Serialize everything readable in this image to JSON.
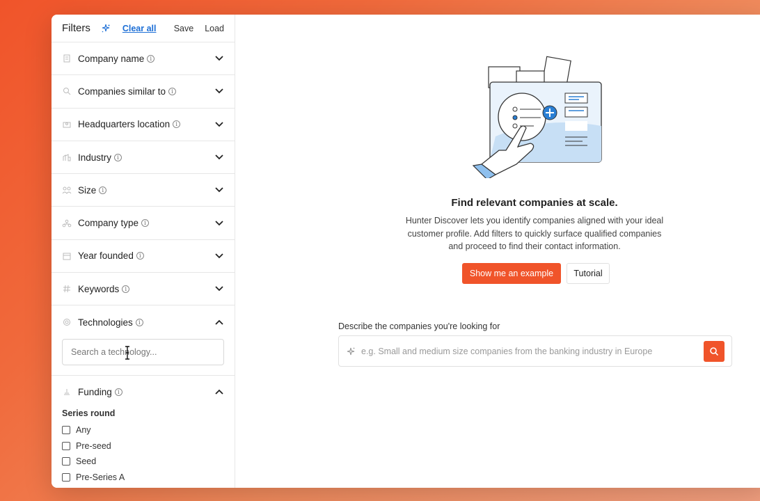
{
  "colors": {
    "accent": "#f0542a",
    "link": "#1d6fd6",
    "background_gradient_start": "#f0542a"
  },
  "filters_header": {
    "title": "Filters",
    "clear_all": "Clear all",
    "save": "Save",
    "load": "Load"
  },
  "filters": [
    {
      "label": "Company name",
      "icon": "building-icon",
      "expanded": false
    },
    {
      "label": "Companies similar to",
      "icon": "search-icon",
      "expanded": false
    },
    {
      "label": "Headquarters location",
      "icon": "map-icon",
      "expanded": false
    },
    {
      "label": "Industry",
      "icon": "factory-icon",
      "expanded": false
    },
    {
      "label": "Size",
      "icon": "people-icon",
      "expanded": false
    },
    {
      "label": "Company type",
      "icon": "hierarchy-icon",
      "expanded": false
    },
    {
      "label": "Year founded",
      "icon": "calendar-icon",
      "expanded": false
    },
    {
      "label": "Keywords",
      "icon": "hash-icon",
      "expanded": false
    },
    {
      "label": "Technologies",
      "icon": "chip-icon",
      "expanded": true
    },
    {
      "label": "Funding",
      "icon": "coins-icon",
      "expanded": true
    }
  ],
  "technologies": {
    "search_placeholder": "Search a technology..."
  },
  "funding": {
    "series_label": "Series round",
    "options": [
      {
        "label": "Any",
        "checked": false
      },
      {
        "label": "Pre-seed",
        "checked": false
      },
      {
        "label": "Seed",
        "checked": false
      },
      {
        "label": "Pre-Series A",
        "checked": false
      }
    ]
  },
  "main": {
    "headline": "Find relevant companies at scale.",
    "description": "Hunter Discover lets you identify companies aligned with your ideal customer profile. Add filters to quickly surface qualified companies and proceed to find their contact information.",
    "primary_button": "Show me an example",
    "secondary_button": "Tutorial",
    "describe_label": "Describe the companies you're looking for",
    "describe_placeholder": "e.g. Small and medium size companies from the banking industry in Europe"
  }
}
